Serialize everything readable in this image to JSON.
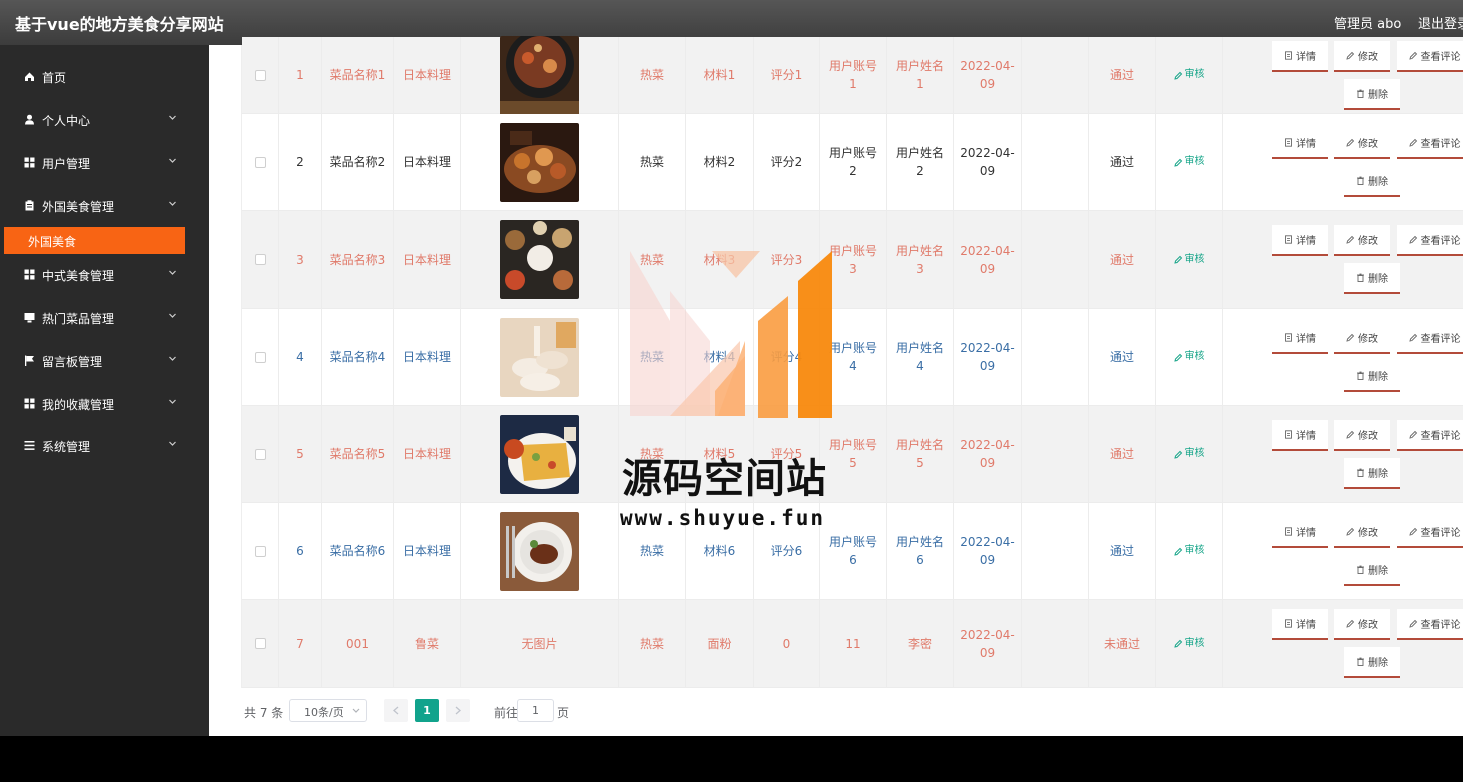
{
  "header": {
    "title": "基于vue的地方美食分享网站",
    "user": "管理员 abo",
    "logout": "退出登录"
  },
  "sidebar": {
    "items": [
      {
        "label": "首页",
        "icon": "home-icon",
        "expandable": false
      },
      {
        "label": "个人中心",
        "icon": "user-icon",
        "expandable": true
      },
      {
        "label": "用户管理",
        "icon": "grid-icon",
        "expandable": true
      },
      {
        "label": "外国美食管理",
        "icon": "clipboard-icon",
        "expandable": true
      },
      {
        "label": "中式美食管理",
        "icon": "grid-icon",
        "expandable": true
      },
      {
        "label": "热门菜品管理",
        "icon": "monitor-icon",
        "expandable": true
      },
      {
        "label": "留言板管理",
        "icon": "flag-icon",
        "expandable": true
      },
      {
        "label": "我的收藏管理",
        "icon": "grid-icon",
        "expandable": true
      },
      {
        "label": "系统管理",
        "icon": "list-icon",
        "expandable": true
      }
    ],
    "active_sub": "外国美食"
  },
  "table": {
    "rows": [
      {
        "index": "1",
        "name": "菜品名称1",
        "category": "日本料理",
        "image": "food-photo-hotpot",
        "type": "热菜",
        "material": "材料1",
        "score": "评分1",
        "account": "用户账号1",
        "username": "用户姓名1",
        "date": "2022-04-09",
        "status": "通过",
        "audit": "审核",
        "text_color": "#e07a6a"
      },
      {
        "index": "2",
        "name": "菜品名称2",
        "category": "日本料理",
        "image": "food-photo-platter",
        "type": "热菜",
        "material": "材料2",
        "score": "评分2",
        "account": "用户账号2",
        "username": "用户姓名2",
        "date": "2022-04-09",
        "status": "通过",
        "audit": "审核",
        "text_color": "#333333"
      },
      {
        "index": "3",
        "name": "菜品名称3",
        "category": "日本料理",
        "image": "food-photo-buns",
        "type": "热菜",
        "material": "材料3",
        "score": "评分3",
        "account": "用户账号3",
        "username": "用户姓名3",
        "date": "2022-04-09",
        "status": "通过",
        "audit": "审核",
        "text_color": "#e07a6a"
      },
      {
        "index": "4",
        "name": "菜品名称4",
        "category": "日本料理",
        "image": "food-photo-dumplings",
        "type": "热菜",
        "material": "材料4",
        "score": "评分4",
        "account": "用户账号4",
        "username": "用户姓名4",
        "date": "2022-04-09",
        "status": "通过",
        "audit": "审核",
        "text_color": "#3a6ea5"
      },
      {
        "index": "5",
        "name": "菜品名称5",
        "category": "日本料理",
        "image": "food-photo-pancake",
        "type": "热菜",
        "material": "材料5",
        "score": "评分5",
        "account": "用户账号5",
        "username": "用户姓名5",
        "date": "2022-04-09",
        "status": "通过",
        "audit": "审核",
        "text_color": "#e07a6a"
      },
      {
        "index": "6",
        "name": "菜品名称6",
        "category": "日本料理",
        "image": "food-photo-steak",
        "type": "热菜",
        "material": "材料6",
        "score": "评分6",
        "account": "用户账号6",
        "username": "用户姓名6",
        "date": "2022-04-09",
        "status": "通过",
        "audit": "审核",
        "text_color": "#3a6ea5"
      },
      {
        "index": "7",
        "name": "001",
        "category": "鲁菜",
        "image_text": "无图片",
        "type": "热菜",
        "material": "面粉",
        "score": "0",
        "account": "11",
        "username": "李密",
        "date": "2022-04-09",
        "status": "未通过",
        "audit": "审核",
        "text_color": "#e07a6a"
      }
    ],
    "actions": {
      "detail": "详情",
      "edit": "修改",
      "comments": "查看评论",
      "delete": "删除"
    }
  },
  "pagination": {
    "total": "共 7 条",
    "page_size": "10条/页",
    "current_page": "1",
    "goto_label": "前往",
    "goto_value": "1",
    "page_suffix": "页"
  },
  "watermark": {
    "text": "源码空间站",
    "url": "www.shuyue.fun"
  },
  "colors": {
    "accent": "#f86414",
    "sidebar_bg": "#2a2a2a",
    "topbar_bg": "#4a4a4a",
    "pager_active": "#11a38c",
    "audit": "#17a589"
  }
}
